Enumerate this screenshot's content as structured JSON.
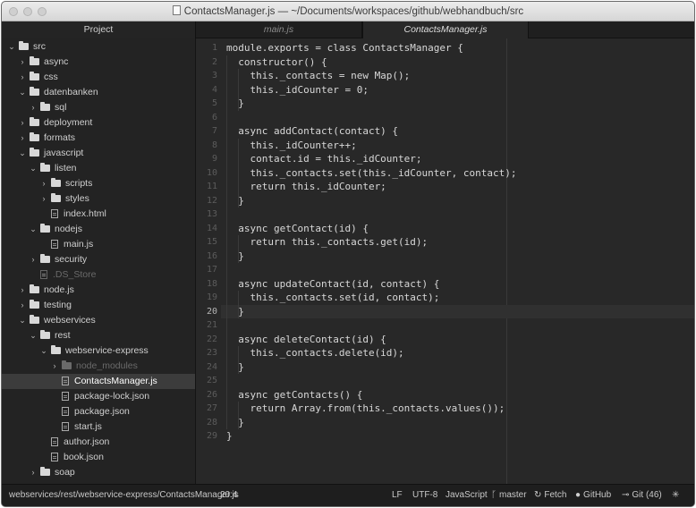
{
  "window": {
    "title": "ContactsManager.js — ~/Documents/workspaces/github/webhandbuch/src"
  },
  "tabs": {
    "project": "Project",
    "main": "main.js",
    "active": "ContactsManager.js"
  },
  "tree": [
    {
      "label": "src",
      "type": "folder",
      "open": true,
      "depth": 0
    },
    {
      "label": "async",
      "type": "folder",
      "open": false,
      "depth": 1
    },
    {
      "label": "css",
      "type": "folder",
      "open": false,
      "depth": 1
    },
    {
      "label": "datenbanken",
      "type": "folder",
      "open": true,
      "depth": 1
    },
    {
      "label": "sql",
      "type": "folder",
      "open": false,
      "depth": 2
    },
    {
      "label": "deployment",
      "type": "folder",
      "open": false,
      "depth": 1
    },
    {
      "label": "formats",
      "type": "folder",
      "open": false,
      "depth": 1
    },
    {
      "label": "javascript",
      "type": "folder",
      "open": true,
      "depth": 1
    },
    {
      "label": "listen",
      "type": "folder",
      "open": true,
      "depth": 2
    },
    {
      "label": "scripts",
      "type": "folder",
      "open": false,
      "depth": 3
    },
    {
      "label": "styles",
      "type": "folder",
      "open": false,
      "depth": 3
    },
    {
      "label": "index.html",
      "type": "file",
      "depth": 3
    },
    {
      "label": "nodejs",
      "type": "folder",
      "open": true,
      "depth": 2
    },
    {
      "label": "main.js",
      "type": "file",
      "depth": 3
    },
    {
      "label": "security",
      "type": "folder",
      "open": false,
      "depth": 2
    },
    {
      "label": ".DS_Store",
      "type": "file",
      "depth": 2,
      "dim": true
    },
    {
      "label": "node.js",
      "type": "folder",
      "open": false,
      "depth": 1
    },
    {
      "label": "testing",
      "type": "folder",
      "open": false,
      "depth": 1
    },
    {
      "label": "webservices",
      "type": "folder",
      "open": true,
      "depth": 1
    },
    {
      "label": "rest",
      "type": "folder",
      "open": true,
      "depth": 2
    },
    {
      "label": "webservice-express",
      "type": "folder",
      "open": true,
      "depth": 3
    },
    {
      "label": "node_modules",
      "type": "folder",
      "open": false,
      "depth": 4,
      "dim": true
    },
    {
      "label": "ContactsManager.js",
      "type": "file",
      "depth": 4,
      "selected": true
    },
    {
      "label": "package-lock.json",
      "type": "file",
      "depth": 4
    },
    {
      "label": "package.json",
      "type": "file",
      "depth": 4
    },
    {
      "label": "start.js",
      "type": "file",
      "depth": 4
    },
    {
      "label": "author.json",
      "type": "file",
      "depth": 3
    },
    {
      "label": "book.json",
      "type": "file",
      "depth": 3
    },
    {
      "label": "soap",
      "type": "folder",
      "open": false,
      "depth": 2
    }
  ],
  "code": {
    "current_line": 20,
    "lines": [
      "module.exports = class ContactsManager {",
      "  constructor() {",
      "    this._contacts = new Map();",
      "    this._idCounter = 0;",
      "  }",
      "",
      "  async addContact(contact) {",
      "    this._idCounter++;",
      "    contact.id = this._idCounter;",
      "    this._contacts.set(this._idCounter, contact);",
      "    return this._idCounter;",
      "  }",
      "",
      "  async getContact(id) {",
      "    return this._contacts.get(id);",
      "  }",
      "",
      "  async updateContact(id, contact) {",
      "    this._contacts.set(id, contact);",
      "  }",
      "",
      "  async deleteContact(id) {",
      "    this._contacts.delete(id);",
      "  }",
      "",
      "  async getContacts() {",
      "    return Array.from(this._contacts.values());",
      "  }",
      "}"
    ]
  },
  "status": {
    "path": "webservices/rest/webservice-express/ContactsManager.js",
    "cursor": "20:4",
    "line_ending": "LF",
    "encoding": "UTF-8",
    "grammar": "JavaScript",
    "branch": "master",
    "fetch": "Fetch",
    "github": "GitHub",
    "git": "Git (46)"
  }
}
